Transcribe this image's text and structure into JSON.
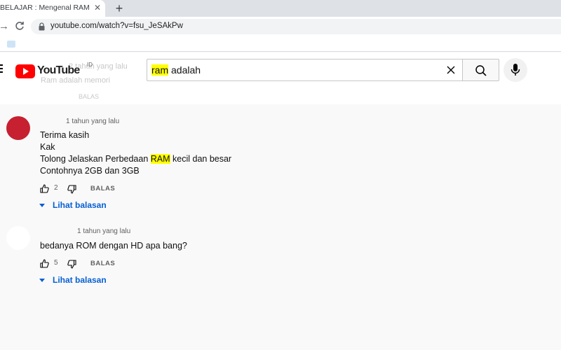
{
  "browser": {
    "tab_title": "BELAJAR : Mengenal RAM dan R",
    "url": "youtube.com/watch?v=fsu_JeSAkPw"
  },
  "youtube": {
    "logo_text": "YouTube",
    "country_code": "ID",
    "search": {
      "highlight": "ram",
      "rest": " adalah"
    },
    "ghost_texts": [
      "2 tahun yang lalu",
      "Ram adalah memori",
      "BALAS"
    ]
  },
  "comments": [
    {
      "time": "1 tahun yang lalu",
      "lines": [
        {
          "text": "Terima kasih"
        },
        {
          "text": "Kak"
        },
        {
          "pre": "Tolong Jelaskan Perbedaan ",
          "highlight": "RAM",
          "post": " kecil dan besar"
        },
        {
          "text": "Contohnya 2GB dan 3GB"
        }
      ],
      "likes": "2",
      "reply_label": "BALAS",
      "view_replies_label": "Lihat balasan",
      "avatar_color": "#c62031"
    },
    {
      "time": "1 tahun yang lalu",
      "lines": [
        {
          "text": "bedanya ROM dengan HD apa bang?"
        }
      ],
      "likes": "5",
      "reply_label": "BALAS",
      "view_replies_label": "Lihat balasan",
      "avatar_color": "#ffffff"
    }
  ],
  "colors": {
    "accent_blue": "#065fd4",
    "search_highlight": "#ffff00",
    "youtube_red": "#ff0000"
  }
}
